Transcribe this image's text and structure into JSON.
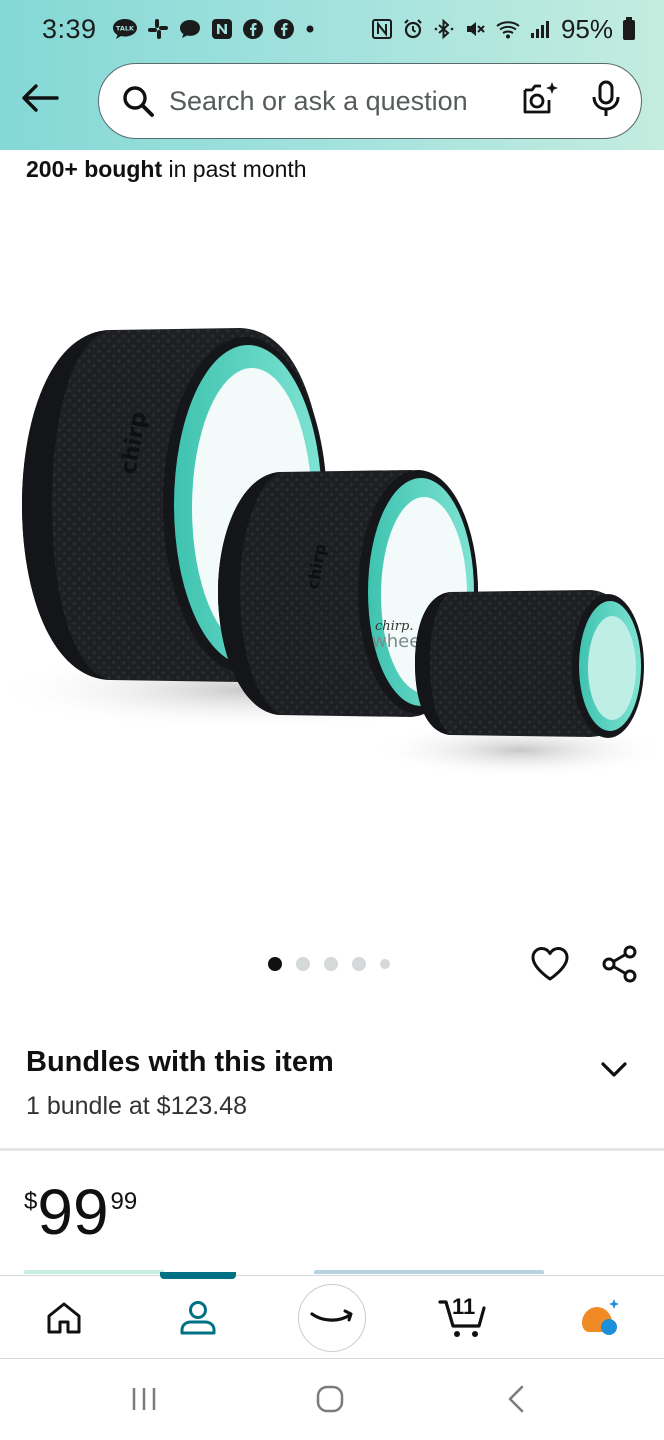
{
  "status_bar": {
    "time": "3:39",
    "battery_percent": "95%",
    "left_icons": [
      "talk-icon",
      "slack-icon",
      "chat-icon",
      "n-icon",
      "facebook-icon",
      "facebook-icon",
      "dot-icon"
    ],
    "right_icons": [
      "nfc-icon",
      "alarm-icon",
      "bluetooth-icon",
      "mute-icon",
      "wifi-icon",
      "signal-icon",
      "battery-icon"
    ]
  },
  "search": {
    "placeholder": "Search or ask a question"
  },
  "product": {
    "bought_bold": "200+ bought",
    "bought_rest": " in past month",
    "image_label_brand": "chirp.",
    "image_label_product": "wheel+",
    "carousel_dot_count": 5,
    "carousel_active_index": 0
  },
  "bundles": {
    "title": "Bundles with this item",
    "subtitle": "1 bundle at $123.48"
  },
  "price": {
    "symbol": "$",
    "whole": "99",
    "fraction": "99"
  },
  "bottom_nav": {
    "items": [
      "home",
      "account",
      "amazon",
      "cart",
      "rufus"
    ],
    "active": "account",
    "cart_count": "11"
  },
  "colors": {
    "header_start": "#84d8d6",
    "header_end": "#c4ecdf",
    "teal_accent": "#007185",
    "wheel_teal": "#5fd6c4",
    "wheel_black": "#1c1d21"
  }
}
